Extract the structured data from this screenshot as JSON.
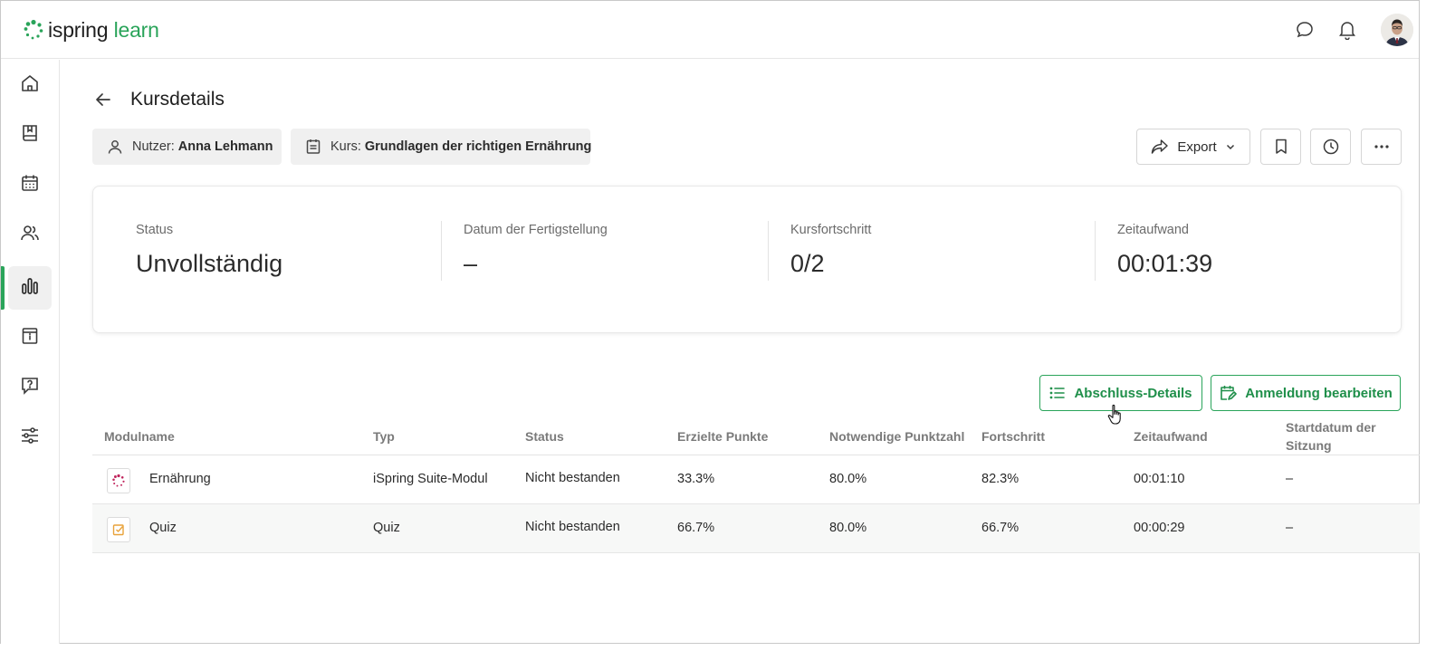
{
  "app": {
    "logo_brand": "ispring",
    "logo_product": "learn"
  },
  "topbar": {
    "icons": [
      "chat-icon",
      "bell-icon",
      "avatar"
    ]
  },
  "sidebar": {
    "items": [
      {
        "icon": "home-icon",
        "active": false
      },
      {
        "icon": "book-icon",
        "active": false
      },
      {
        "icon": "calendar-icon",
        "active": false
      },
      {
        "icon": "users-icon",
        "active": false
      },
      {
        "icon": "reports-icon",
        "active": true
      },
      {
        "icon": "info-page-icon",
        "active": false
      },
      {
        "icon": "question-icon",
        "active": false
      },
      {
        "icon": "settings-sliders-icon",
        "active": false
      }
    ],
    "accent": "#2aa45a"
  },
  "header": {
    "title": "Kursdetails",
    "user_chip": {
      "label": "Nutzer:",
      "value": "Anna Lehmann"
    },
    "course_chip": {
      "label": "Kurs:",
      "value": "Grundlagen der richtigen Ernährung"
    },
    "export_label": "Export"
  },
  "summary": {
    "status": {
      "label": "Status",
      "value": "Unvollständig"
    },
    "completion_date": {
      "label": "Datum der Fertigstellung",
      "value": "–"
    },
    "progress": {
      "label": "Kursfortschritt",
      "value": "0/2"
    },
    "time_spent": {
      "label": "Zeitaufwand",
      "value": "00:01:39"
    }
  },
  "actions": {
    "completion_details": "Abschluss-Details",
    "edit_enrollment": "Anmeldung bearbeiten"
  },
  "table": {
    "headers": {
      "module_name": "Modulname",
      "type": "Typ",
      "status": "Status",
      "score": "Erzielte Punkte",
      "passing_score": "Notwendige Punktzahl",
      "progress": "Fortschritt",
      "time_spent": "Zeitaufwand",
      "session_start": "Startdatum der Sitzung"
    },
    "rows": [
      {
        "name": "Ernährung",
        "type": "iSpring Suite-Modul",
        "status": "Nicht bestanden",
        "score": "33.3%",
        "passing_score": "80.0%",
        "progress": "82.3%",
        "time_spent": "00:01:10",
        "session_start": "–",
        "icon": "ispring-module-icon"
      },
      {
        "name": "Quiz",
        "type": "Quiz",
        "status": "Nicht bestanden",
        "score": "66.7%",
        "passing_score": "80.0%",
        "progress": "66.7%",
        "time_spent": "00:00:29",
        "session_start": "–",
        "icon": "quiz-icon"
      }
    ]
  }
}
